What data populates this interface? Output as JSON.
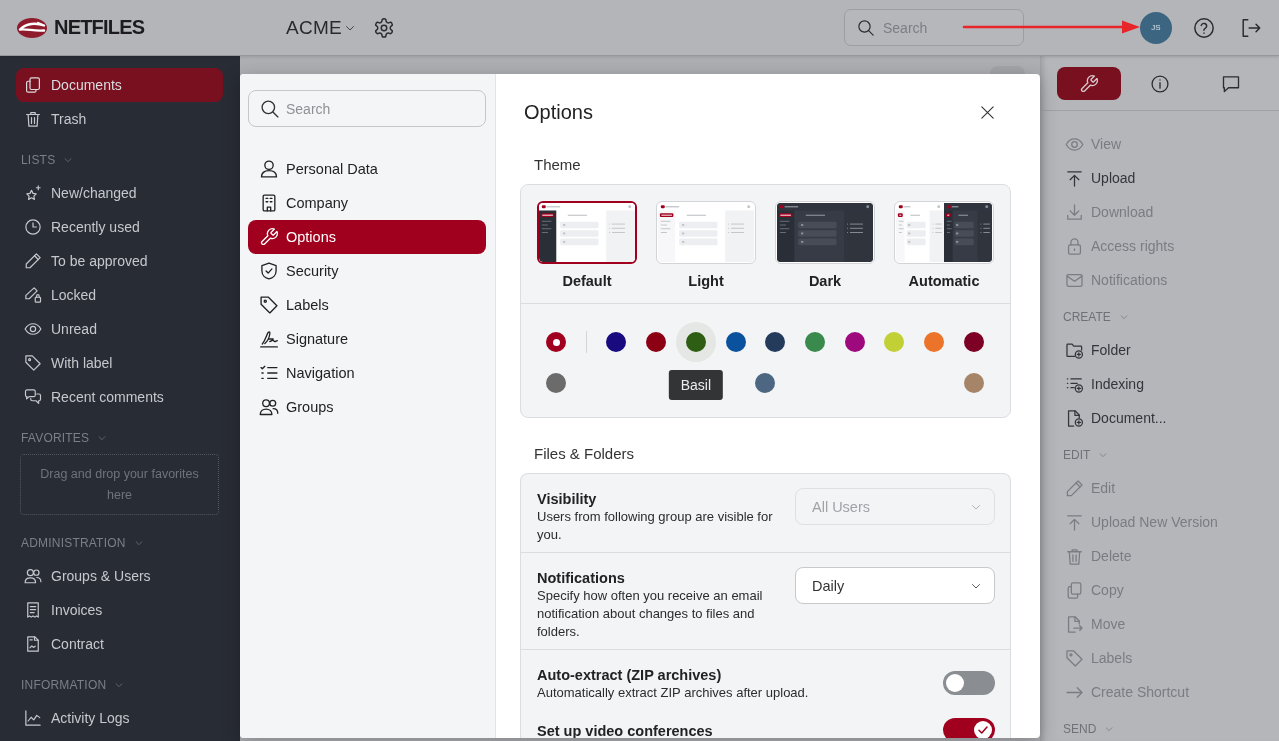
{
  "header": {
    "logo_text": "NETFILES",
    "organization": "ACME",
    "search": {
      "placeholder": "Search"
    },
    "user_initials": "JS"
  },
  "sidebar": {
    "items": [
      {
        "label": "Documents",
        "selected": true
      },
      {
        "label": "Trash",
        "selected": false
      }
    ],
    "sections": [
      {
        "title": "LISTS",
        "items": [
          {
            "label": "New/changed",
            "selected": false
          },
          {
            "label": "Recently used",
            "selected": false
          },
          {
            "label": "To be approved",
            "selected": false
          },
          {
            "label": "Locked",
            "selected": false
          },
          {
            "label": "Unread",
            "selected": false
          },
          {
            "label": "With label",
            "selected": false
          },
          {
            "label": "Recent comments",
            "selected": false
          }
        ]
      },
      {
        "title": "FAVORITES",
        "dropzone": "Drag and drop your favorites here"
      },
      {
        "title": "ADMINISTRATION",
        "items": [
          {
            "label": "Groups & Users",
            "selected": false
          },
          {
            "label": "Invoices",
            "selected": false
          },
          {
            "label": "Contract",
            "selected": false
          }
        ]
      },
      {
        "title": "INFORMATION",
        "items": [
          {
            "label": "Activity Logs",
            "selected": false
          }
        ]
      }
    ]
  },
  "dialog": {
    "search": {
      "placeholder": "Search"
    },
    "nav": [
      {
        "label": "Personal Data",
        "selected": false
      },
      {
        "label": "Company",
        "selected": false
      },
      {
        "label": "Options",
        "selected": true
      },
      {
        "label": "Security",
        "selected": false
      },
      {
        "label": "Labels",
        "selected": false
      },
      {
        "label": "Signature",
        "selected": false
      },
      {
        "label": "Navigation",
        "selected": false
      },
      {
        "label": "Groups",
        "selected": false
      }
    ],
    "title": "Options",
    "theme": {
      "heading": "Theme",
      "options": [
        {
          "kind": "default",
          "label": "Default",
          "selected": true
        },
        {
          "kind": "light",
          "label": "Light",
          "selected": false
        },
        {
          "kind": "dark",
          "label": "Dark",
          "selected": false
        },
        {
          "kind": "automatic",
          "label": "Automatic",
          "selected": false
        }
      ],
      "accent_colors": [
        [
          {
            "color": "#a0001e",
            "selected": true,
            "hovered": false
          },
          {
            "color": "#1a0a80",
            "selected": false,
            "hovered": false
          },
          {
            "color": "#8b0012",
            "selected": false,
            "hovered": false
          },
          {
            "color": "#2e5e14",
            "selected": false,
            "hovered": true,
            "tooltip": "Basil"
          },
          {
            "color": "#0a519e",
            "selected": false,
            "hovered": false
          },
          {
            "color": "#253b5c",
            "selected": false,
            "hovered": false
          },
          {
            "color": "#3a8a4e",
            "selected": false,
            "hovered": false
          },
          {
            "color": "#9e0a7e",
            "selected": false,
            "hovered": false
          },
          {
            "color": "#c0d035",
            "selected": false,
            "hovered": false
          },
          {
            "color": "#ec732a",
            "selected": false,
            "hovered": false
          },
          {
            "color": "#7d0025",
            "selected": false,
            "hovered": false
          }
        ],
        [
          {
            "color": "#6b6b6b",
            "selected": false,
            "hovered": false
          },
          {
            "color": "#4d6782",
            "selected": false,
            "hovered": false
          },
          {
            "color": "#a68468",
            "selected": false,
            "hovered": false
          }
        ]
      ]
    },
    "files_folders": {
      "heading": "Files & Folders",
      "settings": [
        {
          "kind": "select",
          "title": "Visibility",
          "description": "Users from following group are visible for you.",
          "value": "All Users",
          "disabled": true
        },
        {
          "kind": "select",
          "title": "Notifications",
          "description": "Specify how often you receive an email notification about changes to files and folders.",
          "value": "Daily",
          "disabled": false
        },
        {
          "kind": "toggle",
          "title": "Auto-extract (ZIP archives)",
          "description": "Automatically extract ZIP archives after upload.",
          "on": false
        },
        {
          "kind": "toggle",
          "title": "Set up video conferences",
          "on": true
        }
      ]
    }
  },
  "right_panel": {
    "tabs": [
      {
        "selected": true
      },
      {
        "selected": false
      },
      {
        "selected": false
      }
    ],
    "sections": [
      {
        "items": [
          {
            "label": "View",
            "disabled": true
          },
          {
            "label": "Upload",
            "disabled": false
          },
          {
            "label": "Download",
            "disabled": true
          },
          {
            "label": "Access rights",
            "disabled": true
          },
          {
            "label": "Notifications",
            "disabled": true
          }
        ]
      },
      {
        "title": "CREATE",
        "items": [
          {
            "label": "Folder",
            "disabled": false
          },
          {
            "label": "Indexing",
            "disabled": false
          },
          {
            "label": "Document...",
            "disabled": false
          }
        ]
      },
      {
        "title": "EDIT",
        "items": [
          {
            "label": "Edit",
            "disabled": true
          },
          {
            "label": "Upload New Version",
            "disabled": true
          },
          {
            "label": "Delete",
            "disabled": true
          },
          {
            "label": "Copy",
            "disabled": true
          },
          {
            "label": "Move",
            "disabled": true
          },
          {
            "label": "Labels",
            "disabled": true
          },
          {
            "label": "Create Shortcut",
            "disabled": true
          }
        ]
      },
      {
        "title": "SEND"
      }
    ]
  }
}
